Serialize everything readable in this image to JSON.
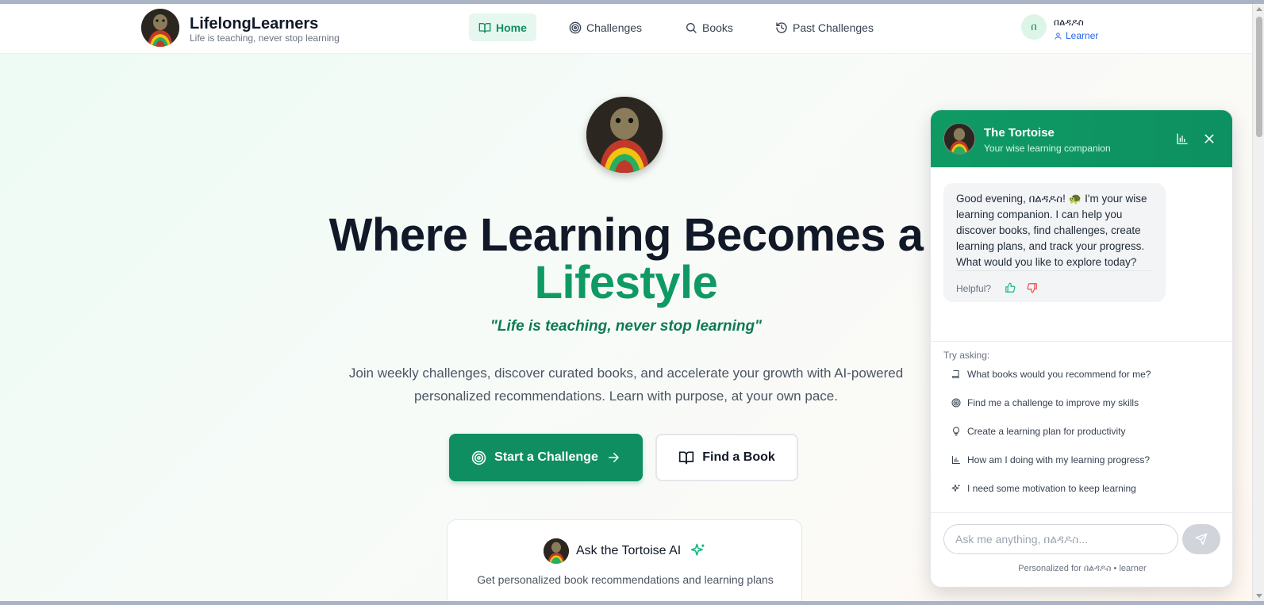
{
  "header": {
    "brand_name": "LifelongLearners",
    "brand_tagline": "Life is teaching, never stop learning",
    "nav": [
      {
        "label": "Home",
        "icon": "book-open-icon",
        "active": true
      },
      {
        "label": "Challenges",
        "icon": "target-icon",
        "active": false
      },
      {
        "label": "Books",
        "icon": "search-icon",
        "active": false
      },
      {
        "label": "Past Challenges",
        "icon": "history-icon",
        "active": false
      }
    ],
    "user": {
      "initial": "በ",
      "name": "በልዳዶስ",
      "role": "Learner"
    }
  },
  "hero": {
    "title_line1": "Where Learning Becomes a",
    "title_line2": "Lifestyle",
    "quote": "\"Life is teaching, never stop learning\"",
    "description": "Join weekly challenges, discover curated books, and accelerate your growth with AI-powered personalized recommendations. Learn with purpose, at your own pace.",
    "primary_button": "Start a Challenge",
    "secondary_button": "Find a Book"
  },
  "ai_card": {
    "title": "Ask the Tortoise AI",
    "description": "Get personalized book recommendations and learning plans"
  },
  "chat": {
    "title": "The Tortoise",
    "subtitle": "Your wise learning companion",
    "message": "Good evening, በልዳዶስ! 🐢 I'm your wise learning companion. I can help you discover books, find challenges, create learning plans, and track your progress. What would you like to explore today?",
    "helpful_label": "Helpful?",
    "try_label": "Try asking:",
    "suggestions": [
      {
        "text": "What books would you recommend for me?",
        "icon": "book-icon"
      },
      {
        "text": "Find me a challenge to improve my skills",
        "icon": "target-icon"
      },
      {
        "text": "Create a learning plan for productivity",
        "icon": "lightbulb-icon"
      },
      {
        "text": "How am I doing with my learning progress?",
        "icon": "bar-chart-icon"
      },
      {
        "text": "I need some motivation to keep learning",
        "icon": "sparkles-icon"
      }
    ],
    "input_placeholder": "Ask me anything, በልዳዶስ...",
    "footer": "Personalized for በልዳዶስ • learner"
  },
  "colors": {
    "brand_green": "#0f8f61",
    "accent_blue": "#2563eb",
    "text_dark": "#111827"
  }
}
